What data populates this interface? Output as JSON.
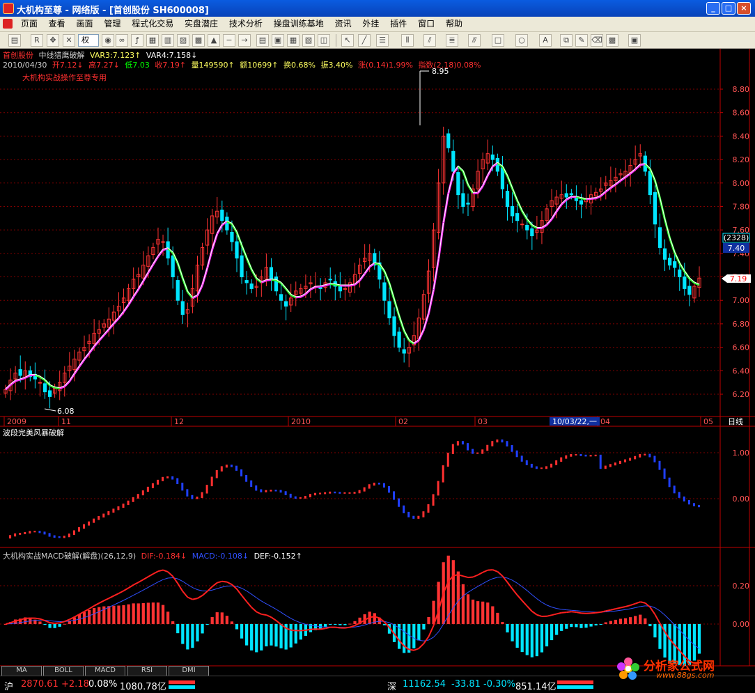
{
  "window": {
    "title": "大机构至尊  - 网络版 - [首创股份 SH600008]",
    "min_label": "_",
    "max_label": "□",
    "close_label": "×"
  },
  "menu": [
    "页面",
    "查看",
    "画面",
    "管理",
    "程式化交易",
    "实盘潜庄",
    "技术分析",
    "操盘训练基地",
    "资讯",
    "外挂",
    "插件",
    "窗口",
    "帮助"
  ],
  "toolbar": {
    "rights_select": "权",
    "icons": [
      "open-icon",
      "rsi-icon",
      "move-icon",
      "delete-icon",
      "refresh-icon",
      "link-icon",
      "formula-icon",
      "diagram-icon",
      "stats-icon",
      "alarm-icon",
      "minus-icon",
      "arrow-icon",
      "layout-icon",
      "grid-icon",
      "chart-icon",
      "chart2-icon",
      "cursor-icon",
      "line-icon",
      "text-icon",
      "bars-icon",
      "fan-icon",
      "channel-icon",
      "parallel-icon",
      "rect-icon",
      "ellipse-icon",
      "font-icon",
      "copy-icon",
      "pencil-icon",
      "eraser-icon",
      "color-icon",
      "save-icon"
    ]
  },
  "main_panel": {
    "stock_name": "首创股份",
    "indicator_name": "中线猎鹰破解",
    "var3": "VAR3:7.123↑",
    "var4": "VAR4:7.158↓",
    "date": "2010/04/30",
    "open": "开7.12↓",
    "high": "高7.27↓",
    "low": "低7.03",
    "close": "收7.19↑",
    "volume": "量149590↑",
    "amount": "额10699↑",
    "turnover": "换0.68%",
    "amplitude": "振3.40%",
    "change": "涨(0.14)1.99%",
    "index": "指数(2.18)0.08%",
    "subtitle": "大机构实战操作至尊专用",
    "high_marker": "8.95",
    "low_marker": "6.08",
    "price_ticks": [
      "8.80",
      "8.60",
      "8.40",
      "8.20",
      "8.00",
      "7.80",
      "7.60",
      "7.40",
      "7.20",
      "7.00",
      "6.80",
      "6.60",
      "6.40",
      "6.20"
    ],
    "cursor_count": "(2328)",
    "cursor_price": "7.40",
    "last_price": "7.19"
  },
  "time_axis": {
    "labels": [
      "2009",
      "11",
      "12",
      "2010",
      "02",
      "03",
      "04",
      "05"
    ],
    "cursor_date": "10/03/22,一",
    "period": "日线"
  },
  "panel2": {
    "title": "波段完美风暴破解",
    "ticks": [
      "1.00",
      "0.00"
    ]
  },
  "panel3": {
    "title": "大机构实战MACD破解(解盘)(26,12,9)",
    "dif": "DIF:-0.184↓",
    "macd": "MACD:-0.108↓",
    "dea": "DEF:-0.152↑",
    "ticks": [
      "0.20",
      "0.00"
    ]
  },
  "tabs": [
    "MA",
    "BOLL",
    "MACD",
    "RSI",
    "DMI"
  ],
  "status": {
    "sh_label": "沪",
    "sh_index": "2870.61",
    "sh_change": "+2.18",
    "sh_pct": "0.08%",
    "sh_amount": "1080.78亿",
    "sz_label": "深",
    "sz_index": "11162.54",
    "sz_change": "-33.81",
    "sz_pct": "-0.30%",
    "sz_amount": "851.14亿"
  },
  "watermark": {
    "text": "分析家公式网",
    "url": "www.88gs.com"
  },
  "colors": {
    "up": "#ff3333",
    "down": "#00e5ff",
    "ma_up": "#ff33ff",
    "ma_down": "#33ff33",
    "grid": "#800000",
    "axis_text": "#ff5555",
    "dif": "#ff2020",
    "dea": "#3050ff",
    "signal_up": "#ff3030",
    "signal_down": "#2040ff"
  }
}
